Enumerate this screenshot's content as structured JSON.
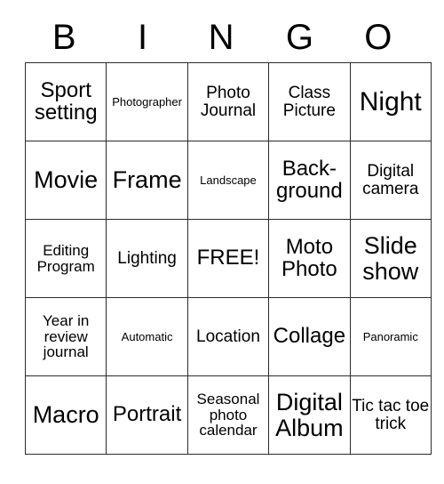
{
  "card": {
    "header": {
      "letters": [
        "B",
        "I",
        "N",
        "G",
        "O"
      ]
    },
    "rows": [
      [
        {
          "text": "Sport setting",
          "size": "fs-md"
        },
        {
          "text": "Photographer",
          "size": "fs-xxs"
        },
        {
          "text": "Photo Journal",
          "size": "fs-sm"
        },
        {
          "text": "Class Picture",
          "size": "fs-sm"
        },
        {
          "text": "Night",
          "size": "fs-xl"
        }
      ],
      [
        {
          "text": "Movie",
          "size": "fs-lg"
        },
        {
          "text": "Frame",
          "size": "fs-lg"
        },
        {
          "text": "Landscape",
          "size": "fs-xxs"
        },
        {
          "text": "Back-ground",
          "size": "fs-md"
        },
        {
          "text": "Digital camera",
          "size": "fs-sm"
        }
      ],
      [
        {
          "text": "Editing Program",
          "size": "fs-xs"
        },
        {
          "text": "Lighting",
          "size": "fs-sm"
        },
        {
          "text": "FREE!",
          "size": "fs-md"
        },
        {
          "text": "Moto Photo",
          "size": "fs-md"
        },
        {
          "text": "Slide show",
          "size": "fs-lg"
        }
      ],
      [
        {
          "text": "Year in review journal",
          "size": "fs-xs"
        },
        {
          "text": "Automatic",
          "size": "fs-xxs"
        },
        {
          "text": "Location",
          "size": "fs-sm"
        },
        {
          "text": "Collage",
          "size": "fs-md"
        },
        {
          "text": "Panoramic",
          "size": "fs-xxs"
        }
      ],
      [
        {
          "text": "Macro",
          "size": "fs-lg"
        },
        {
          "text": "Portrait",
          "size": "fs-md"
        },
        {
          "text": "Seasonal photo calendar",
          "size": "fs-xs"
        },
        {
          "text": "Digital Album",
          "size": "fs-lg"
        },
        {
          "text": "Tic tac toe trick",
          "size": "fs-sm"
        }
      ]
    ]
  },
  "colors": {
    "border": "#2b2b2b",
    "text": "#000000",
    "background": "#ffffff"
  }
}
